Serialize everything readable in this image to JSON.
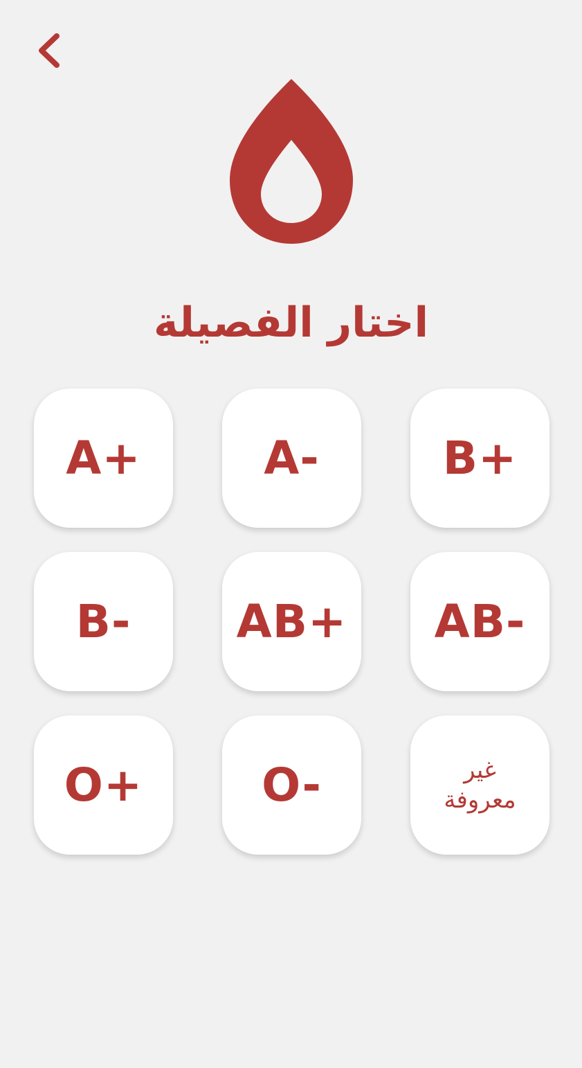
{
  "header": {
    "back_icon": "chevron-left-icon",
    "logo_icon": "blood-drop-icon"
  },
  "title": "اختار الفصيلة",
  "colors": {
    "accent": "#b43934",
    "background": "#f2f1f1",
    "tile": "#ffffff"
  },
  "blood_types": [
    {
      "label": "B+"
    },
    {
      "label": "A-"
    },
    {
      "label": "A+"
    },
    {
      "label": "AB-"
    },
    {
      "label": "AB+"
    },
    {
      "label": "B-"
    },
    {
      "label": "غير معروفة"
    },
    {
      "label": "O-"
    },
    {
      "label": "O+"
    }
  ]
}
